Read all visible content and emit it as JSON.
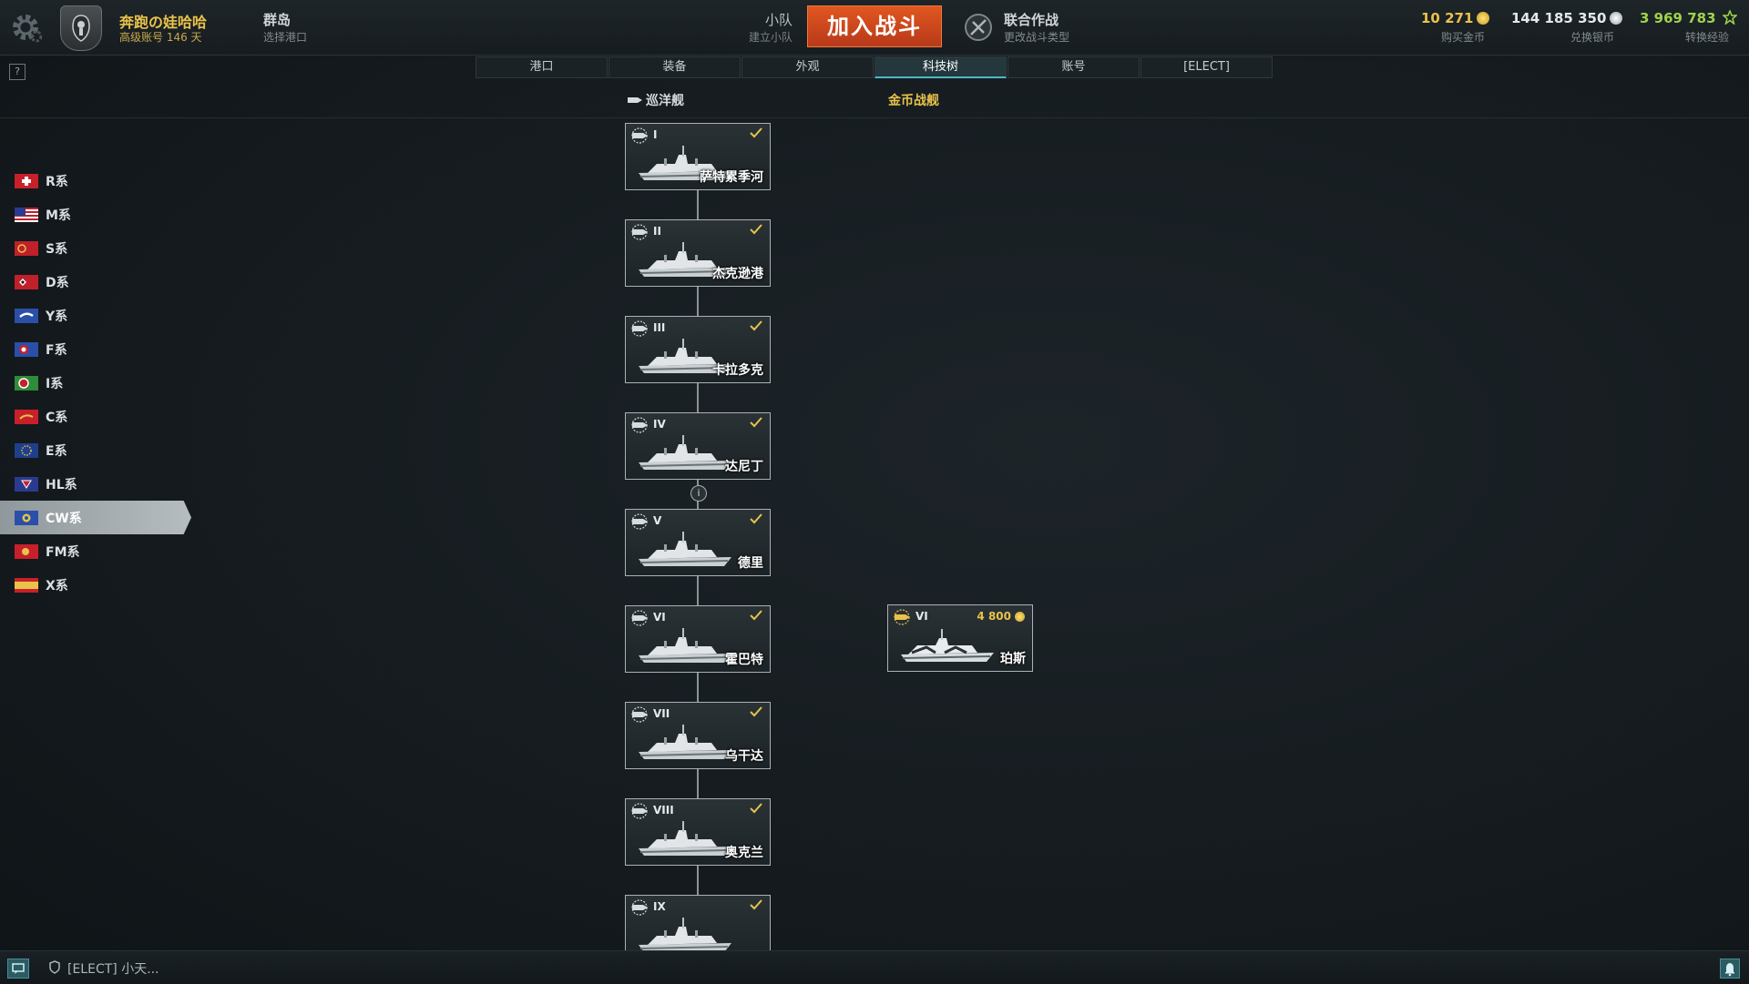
{
  "topbar": {
    "player_name": "奔跑の娃哈哈",
    "account_type": "高级账号 146 天",
    "port_name": "群岛",
    "port_sub": "选择港口",
    "squad_title": "小队",
    "squad_sub": "建立小队",
    "battle_button": "加入战斗",
    "mode_title": "联合作战",
    "mode_sub": "更改战斗类型",
    "gold_value": "10 271",
    "gold_label": "购买金币",
    "silver_value": "144 185 350",
    "silver_label": "兑换银币",
    "xp_value": "3 969 783",
    "xp_label": "转换经验",
    "help": "?"
  },
  "tabs": [
    {
      "label": "港口",
      "active": false
    },
    {
      "label": "装备",
      "active": false
    },
    {
      "label": "外观",
      "active": false
    },
    {
      "label": "科技树",
      "active": true
    },
    {
      "label": "账号",
      "active": false
    },
    {
      "label": "[ELECT]",
      "active": false
    }
  ],
  "subheaders": {
    "cruiser": "巡洋舰",
    "premium": "金币战舰"
  },
  "nations": [
    {
      "label": "R系",
      "flag": "red-cross-flag"
    },
    {
      "label": "M系",
      "flag": "usa-flag"
    },
    {
      "label": "S系",
      "flag": "ussr-flag"
    },
    {
      "label": "D系",
      "flag": "germany-flag"
    },
    {
      "label": "Y系",
      "flag": "uk-flag"
    },
    {
      "label": "F系",
      "flag": "france-flag"
    },
    {
      "label": "I系",
      "flag": "italy-flag"
    },
    {
      "label": "C系",
      "flag": "china-flag"
    },
    {
      "label": "E系",
      "flag": "europe-flag"
    },
    {
      "label": "HL系",
      "flag": "netherlands-flag"
    },
    {
      "label": "CW系",
      "flag": "commonwealth-flag",
      "active": true
    },
    {
      "label": "FM系",
      "flag": "pan-america-flag"
    },
    {
      "label": "X系",
      "flag": "spain-flag"
    }
  ],
  "ships": [
    {
      "tier": "I",
      "name": "萨特累季河",
      "researched": true
    },
    {
      "tier": "II",
      "name": "杰克逊港",
      "researched": true
    },
    {
      "tier": "III",
      "name": "卡拉多克",
      "researched": true
    },
    {
      "tier": "IV",
      "name": "达尼丁",
      "researched": true
    },
    {
      "tier": "V",
      "name": "德里",
      "researched": true
    },
    {
      "tier": "VI",
      "name": "霍巴特",
      "researched": true
    },
    {
      "tier": "VII",
      "name": "乌干达",
      "researched": true
    },
    {
      "tier": "VIII",
      "name": "奥克兰",
      "researched": true
    },
    {
      "tier": "IX",
      "name": "",
      "researched": true
    }
  ],
  "premium_ship": {
    "tier": "VI",
    "name": "珀斯",
    "price": "4 800"
  },
  "info_badge": "i",
  "bottombar": {
    "clan_chat": "[ELECT]  小天..."
  },
  "colors": {
    "gold": "#e8c24a",
    "battle_button": "#d24a1c",
    "active_tab": "#4fb7c0",
    "xp_green": "#9fd34a"
  }
}
